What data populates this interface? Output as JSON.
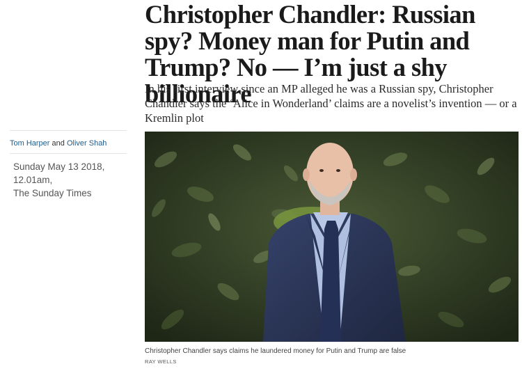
{
  "article": {
    "headline": "Christopher Chandler: Russian spy? Money man for Putin and Trump? No — I’m just a shy billionaire",
    "standfirst": "In his first interview since an MP alleged he was a Russian spy, Christopher Chandler says the ‘Alice in Wonderland’ claims are a novelist’s invention — or a Kremlin plot",
    "authors": [
      "Tom Harper",
      "Oliver Shah"
    ],
    "author_joiner": "and",
    "dateline": "Sunday May 13 2018, 12.01am,",
    "publication": "The Sunday Times",
    "image": {
      "subject": "man-in-suit-portrait",
      "caption": "Christopher Chandler says claims he laundered money for Putin and Trump are false",
      "credit": "RAY WELLS"
    }
  },
  "colors": {
    "author_link": "#1f5b8a",
    "headline": "#1a1a1a",
    "foliage": "#2f3a26",
    "suit": "#2a3550"
  }
}
